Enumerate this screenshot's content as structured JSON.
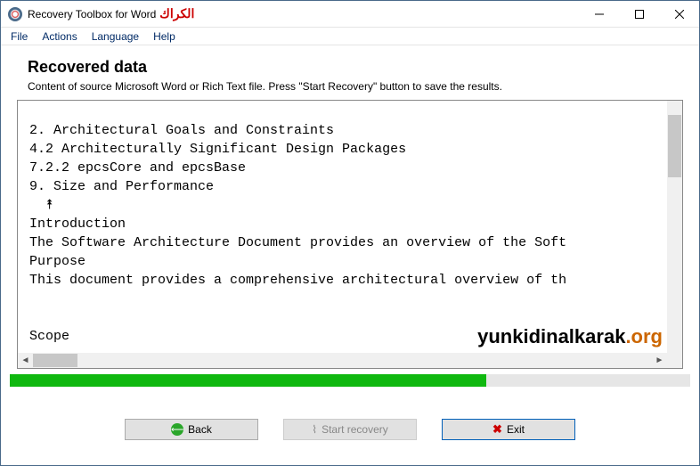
{
  "titlebar": {
    "title": "Recovery Toolbox for Word",
    "suffix": "الكراك"
  },
  "menubar": {
    "items": [
      "File",
      "Actions",
      "Language",
      "Help"
    ]
  },
  "page": {
    "title": "Recovered data",
    "description": "Content of source Microsoft Word or Rich Text file. Press \"Start Recovery\" button to save the results."
  },
  "recovered_text": "￼\n 2. Architectural Goals and Constraints ￼\n 4.2 Architecturally Significant Design Packages ￼\n 7.2.2 epcsCore and epcsBase ￼\n 9. Size and Performance ￼\n ￼ ⯭￼\n Introduction\n The Software Architecture Document provides an overview of the Soft\n Purpose\n This document provides a comprehensive architectural overview of th\n \n \n Scope",
  "watermark": {
    "domain": "yunkidinalkarak",
    "tld": ".org"
  },
  "progress": {
    "percent": 70
  },
  "buttons": {
    "back": "Back",
    "start": "Start recovery",
    "exit": "Exit"
  }
}
